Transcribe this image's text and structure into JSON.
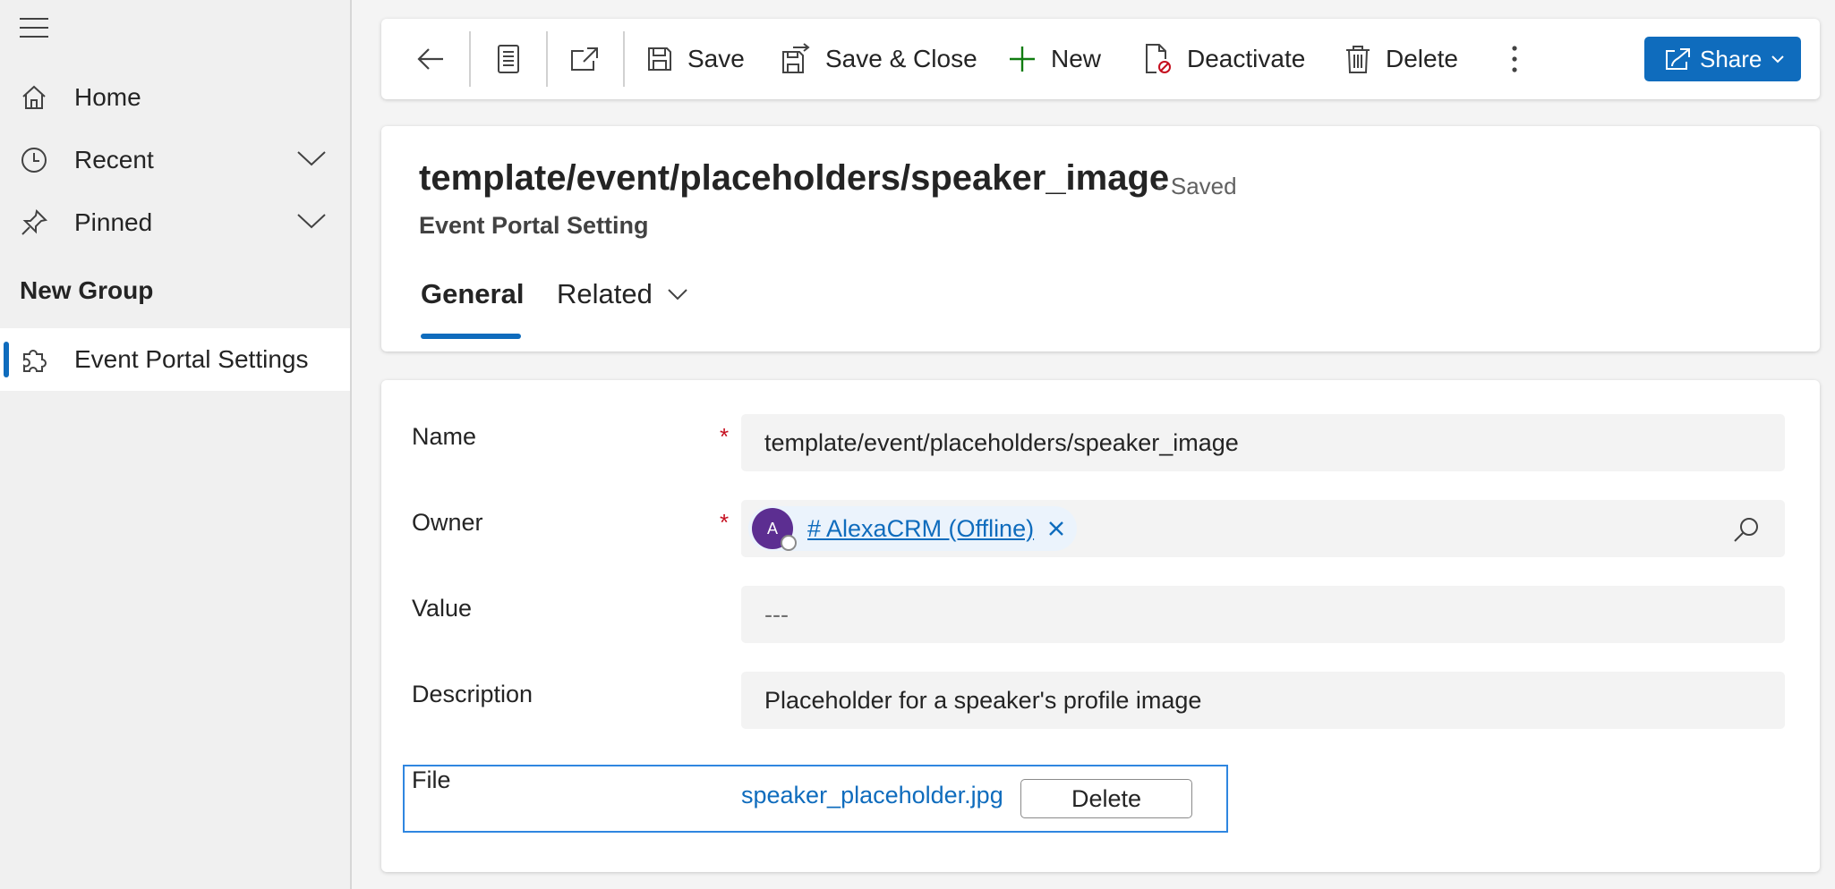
{
  "sidebar": {
    "items": [
      {
        "label": "Home",
        "icon": "home-icon"
      },
      {
        "label": "Recent",
        "icon": "clock-icon"
      },
      {
        "label": "Pinned",
        "icon": "pin-icon"
      }
    ],
    "group_title": "New Group",
    "group_items": [
      {
        "label": "Event Portal Settings",
        "icon": "puzzle-icon",
        "active": true
      }
    ]
  },
  "toolbar": {
    "save": "Save",
    "save_close": "Save & Close",
    "new": "New",
    "deactivate": "Deactivate",
    "delete": "Delete",
    "share": "Share"
  },
  "record": {
    "title": "template/event/placeholders/speaker_image",
    "status": "- Saved",
    "entity": "Event Portal Setting"
  },
  "tabs": [
    {
      "label": "General",
      "active": true
    },
    {
      "label": "Related",
      "active": false
    }
  ],
  "form": {
    "name": {
      "label": "Name",
      "required": "*",
      "value": "template/event/placeholders/speaker_image"
    },
    "owner": {
      "label": "Owner",
      "required": "*",
      "avatar_initial": "A",
      "value": "# AlexaCRM (Offline)"
    },
    "value": {
      "label": "Value",
      "value": "---"
    },
    "description": {
      "label": "Description",
      "value": "Placeholder for a speaker's profile image"
    },
    "file": {
      "label": "File",
      "filename": "speaker_placeholder.jpg",
      "delete_label": "Delete"
    }
  },
  "colors": {
    "accent": "#0f6cbd",
    "required": "#c50f1f",
    "avatar": "#5c2e91",
    "new_icon": "#107c10",
    "deactivate_badge": "#c50f1f"
  }
}
